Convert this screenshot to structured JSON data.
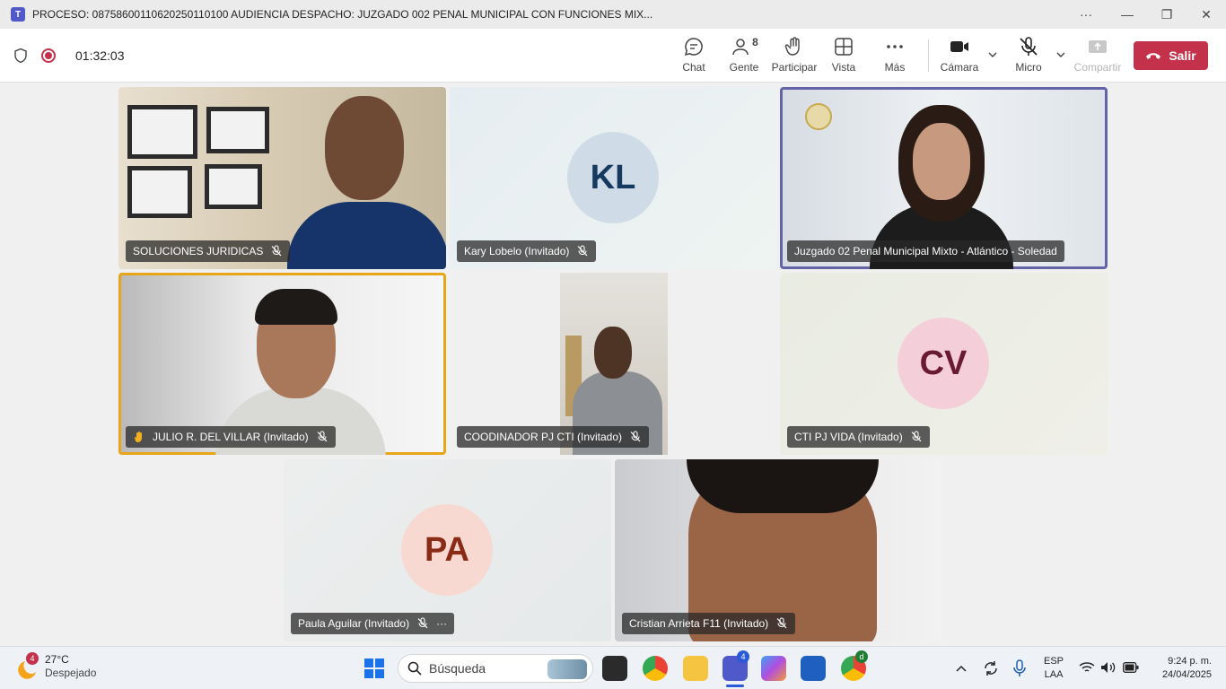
{
  "window": {
    "title": "PROCESO: 08758600110620250110100 AUDIENCIA DESPACHO: JUZGADO 002 PENAL MUNICIPAL CON FUNCIONES MIX...",
    "more": "···",
    "minimize": "—",
    "restore": "❐",
    "close": "✕"
  },
  "toolbar": {
    "timer": "01:32:03",
    "chat": "Chat",
    "people": "Gente",
    "people_count": "8",
    "raise": "Participar",
    "view": "Vista",
    "more": "Más",
    "camera": "Cámara",
    "mic": "Micro",
    "share": "Compartir",
    "leave": "Salir"
  },
  "participants": [
    {
      "name": "SOLUCIONES JURIDICAS"
    },
    {
      "name": "Kary Lobelo (Invitado)",
      "initials": "KL"
    },
    {
      "name": "Juzgado 02 Penal Municipal Mixto - Atlántico - Soledad"
    },
    {
      "name": "JULIO R. DEL VILLAR (Invitado)"
    },
    {
      "name": "COODINADOR PJ CTI (Invitado)"
    },
    {
      "name": "CTI PJ VIDA (Invitado)",
      "initials": "CV"
    },
    {
      "name": "Paula Aguilar (Invitado)",
      "initials": "PA",
      "more": "···"
    },
    {
      "name": "Cristian Arrieta F11 (Invitado)"
    }
  ],
  "colors": {
    "accent": "#6264a7",
    "leave": "#c4314b",
    "raised_hand": "#e8a519",
    "kl_bg": "#cfdbe6",
    "kl_fg": "#163a5f",
    "cv_bg": "#f4cfd9",
    "cv_fg": "#6b1a33",
    "pa_bg": "#f8d9d2",
    "pa_fg": "#8a2b16"
  },
  "taskbar": {
    "weather_badge": "4",
    "temperature": "27°C",
    "weather": "Despejado",
    "search": "Búsqueda",
    "teams_badge": "4",
    "chrome_badge": "d",
    "lang": "ESP",
    "layout": "LAA",
    "time": "9:24 p. m.",
    "date": "24/04/2025"
  }
}
